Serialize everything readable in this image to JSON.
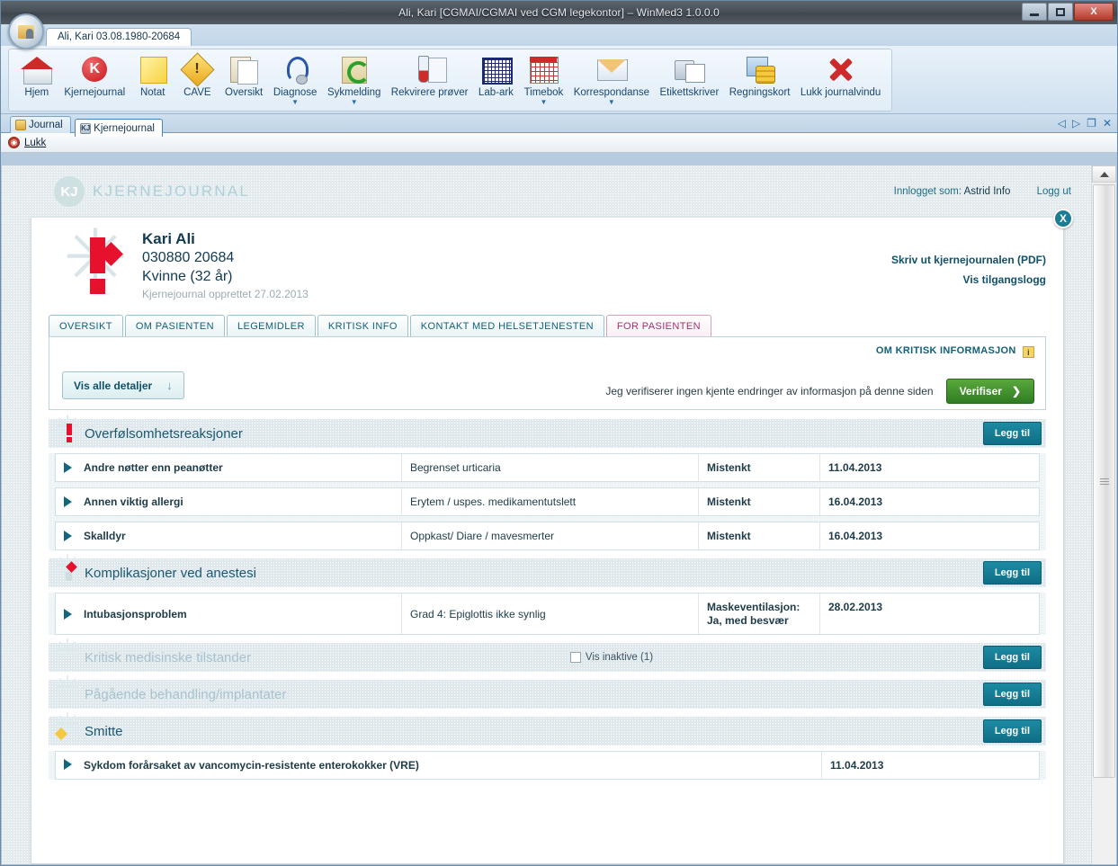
{
  "window": {
    "title": "Ali, Kari [CGMAI/CGMAI ved CGM legekontor] – WinMed3 1.0.0.0",
    "patient_tab": "Ali, Kari 03.08.1980-20684",
    "minimize": "–",
    "maximize": "□",
    "close": "X"
  },
  "ribbon": {
    "buttons": [
      {
        "label": "Hjem",
        "icon": "home-icon",
        "caret": false
      },
      {
        "label": "Kjernejournal",
        "icon": "kjernejournal-icon",
        "caret": false
      },
      {
        "label": "Notat",
        "icon": "note-icon",
        "caret": false
      },
      {
        "label": "CAVE",
        "icon": "warning-diamond-icon",
        "caret": false
      },
      {
        "label": "Oversikt",
        "icon": "documents-icon",
        "caret": false
      },
      {
        "label": "Diagnose",
        "icon": "stethoscope-icon",
        "caret": true
      },
      {
        "label": "Sykmelding",
        "icon": "disability-folder-icon",
        "caret": true
      },
      {
        "label": "Rekvirere prøver",
        "icon": "test-tube-icon",
        "caret": false
      },
      {
        "label": "Lab-ark",
        "icon": "lab-grid-icon",
        "caret": false
      },
      {
        "label": "Timebok",
        "icon": "calendar-icon",
        "caret": true
      },
      {
        "label": "Korrespondanse",
        "icon": "envelope-icon",
        "caret": true
      },
      {
        "label": "Etikettskriver",
        "icon": "printer-icon",
        "caret": false
      },
      {
        "label": "Regningskort",
        "icon": "coins-card-icon",
        "caret": false
      },
      {
        "label": "Lukk journalvindu",
        "icon": "red-x-icon",
        "caret": false
      }
    ]
  },
  "doctabs": {
    "tabs": [
      {
        "label": "Journal",
        "icon": "journal-folder-icon",
        "active": false
      },
      {
        "label": "Kjernejournal",
        "icon": "kj-badge-icon",
        "active": true
      }
    ],
    "nav": {
      "prev": "◁",
      "next": "▷",
      "restore": "❐",
      "close": "✕"
    }
  },
  "lukkbar": {
    "label": "Lukk",
    "icon": "stop-icon"
  },
  "kjheader": {
    "logo_mark": "KJ",
    "logo_text": "KJERNEJOURNAL",
    "logged_in_label": "Innlogget som:",
    "logged_in_user": "Astrid Info",
    "logout": "Logg ut"
  },
  "patient": {
    "name": "Kari Ali",
    "id": "030880 20684",
    "sex_age": "Kvinne (32 år)",
    "created": "Kjernejournal opprettet 27.02.2013",
    "actions": [
      "Skriv ut kjernejournalen (PDF)",
      "Vis tilgangslogg"
    ],
    "close_badge": "X"
  },
  "tabs": [
    {
      "label": "OVERSIKT",
      "selected": false
    },
    {
      "label": "OM PASIENTEN",
      "selected": false
    },
    {
      "label": "LEGEMIDLER",
      "selected": false
    },
    {
      "label": "KRITISK INFO",
      "selected": false
    },
    {
      "label": "KONTAKT MED HELSETJENESTEN",
      "selected": false
    },
    {
      "label": "FOR PASIENTEN",
      "selected": true
    }
  ],
  "verifybox": {
    "heading": "OM KRITISK INFORMASJON",
    "info_badge": "i",
    "details_button": "Vis alle detaljer",
    "details_arrow": "↓",
    "verify_text": "Jeg verifiserer ingen kjente endringer av informasjon på denne siden",
    "verify_button": "Verifiser",
    "verify_arrow": "❯"
  },
  "add_label": "Legg til",
  "sections": [
    {
      "title": "Overfølsomhetsreaksjoner",
      "icon": "exclamation-star-icon",
      "inactive": false,
      "add": "Legg til",
      "rows": [
        {
          "name": "Andre nøtter enn peanøtter",
          "desc": "Begrenset urticaria",
          "status": "Mistenkt",
          "date": "11.04.2013"
        },
        {
          "name": "Annen viktig allergi",
          "desc": "Erytem / uspes. medikamentutslett",
          "status": "Mistenkt",
          "date": "16.04.2013"
        },
        {
          "name": "Skalldyr",
          "desc": "Oppkast/ Diare / mavesmerter",
          "status": "Mistenkt",
          "date": "16.04.2013"
        }
      ]
    },
    {
      "title": "Komplikasjoner ved anestesi",
      "icon": "pin-star-icon",
      "inactive": false,
      "add": "Legg til",
      "rows": [
        {
          "name": "Intubasjonsproblem",
          "desc": "Grad 4: Epiglottis ikke synlig",
          "status": "Maskeventilasjon:",
          "status2": "Ja, med besvær",
          "date": "28.02.2013"
        }
      ]
    },
    {
      "title": "Kritisk medisinske tilstander",
      "icon": "star-icon",
      "inactive": true,
      "add": "Legg til",
      "checkbox": "Vis inaktive (1)",
      "rows": []
    },
    {
      "title": "Pågående behandling/implantater",
      "icon": "star-icon",
      "inactive": true,
      "add": "Legg til",
      "rows": []
    },
    {
      "title": "Smitte",
      "icon": "yellow-diamond-star-icon",
      "inactive": false,
      "add": "Legg til",
      "rows": [
        {
          "name": "Sykdom forårsaket av vancomycin-resistente enterokokker (VRE)",
          "wide": true,
          "date": "11.04.2013"
        }
      ]
    }
  ],
  "colors": {
    "teal": "#10617a",
    "accent_red": "#e8112d",
    "green": "#2f7d23",
    "magenta": "#a0336e"
  }
}
